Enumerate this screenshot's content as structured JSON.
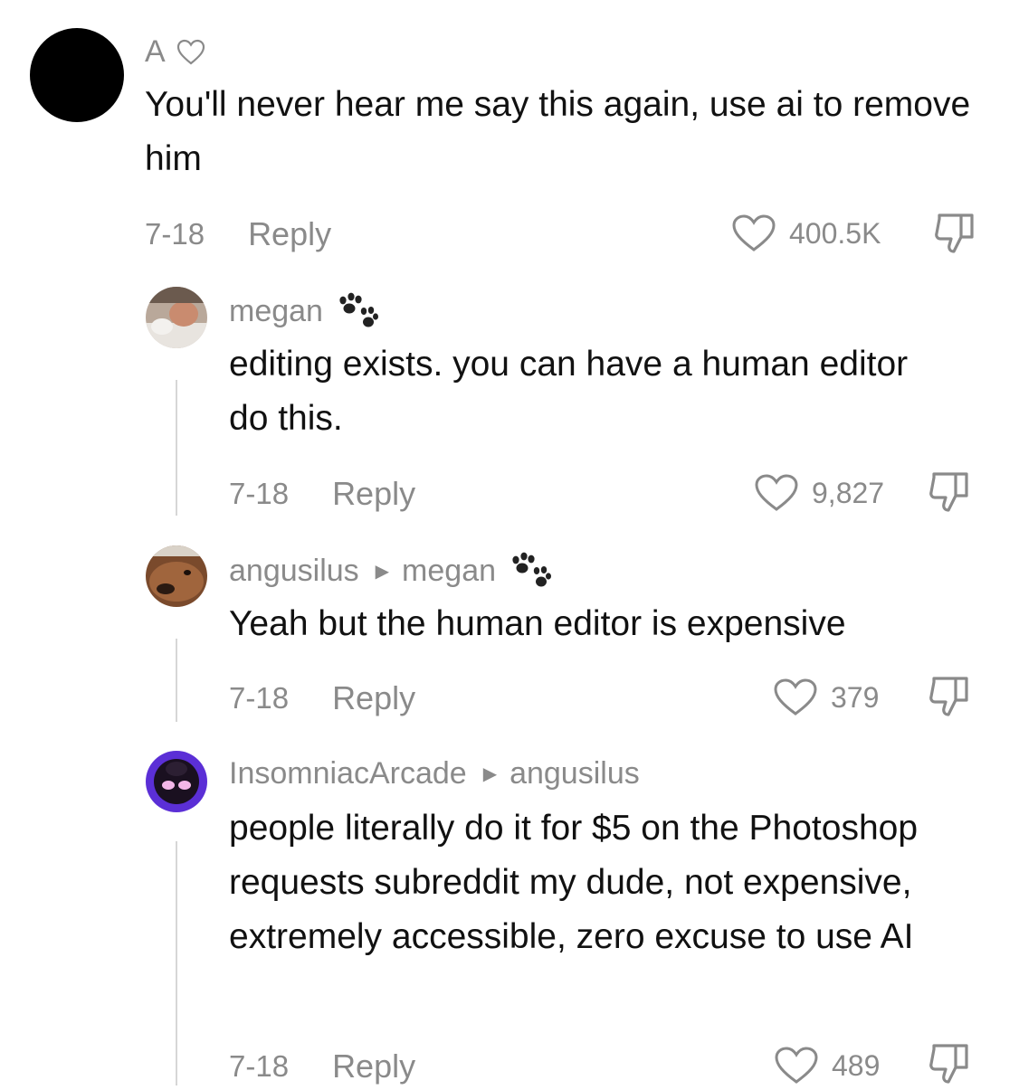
{
  "comments": [
    {
      "username": "A",
      "username_badge": "heart-outline-icon",
      "text": "You'll never hear me say this again, use ai to remove him",
      "date": "7-18",
      "reply_label": "Reply",
      "likes": "400.5K"
    },
    {
      "username": "megan",
      "username_badge": "paw-print-icon",
      "text": "editing exists. you can have a human editor do this.",
      "date": "7-18",
      "reply_label": "Reply",
      "likes": "9,827"
    },
    {
      "username": "angusilus",
      "reply_to": "megan",
      "reply_to_badge": "paw-print-icon",
      "text": "Yeah but the human editor is expensive",
      "date": "7-18",
      "reply_label": "Reply",
      "likes": "379"
    },
    {
      "username": "InsomniacArcade",
      "reply_to": "angusilus",
      "text": "people literally do it for $5 on the Photoshop requests subreddit my dude, not expensive, extremely accessible, zero excuse to use AI",
      "date": "7-18",
      "reply_label": "Reply",
      "likes": "489"
    }
  ],
  "colors": {
    "muted_text": "#8a8a8a",
    "body_text": "#111111",
    "thread_line": "#d6d6d6",
    "avatar_a": "#000000",
    "avatar_insomniac_bg": "#5b2fd6"
  }
}
